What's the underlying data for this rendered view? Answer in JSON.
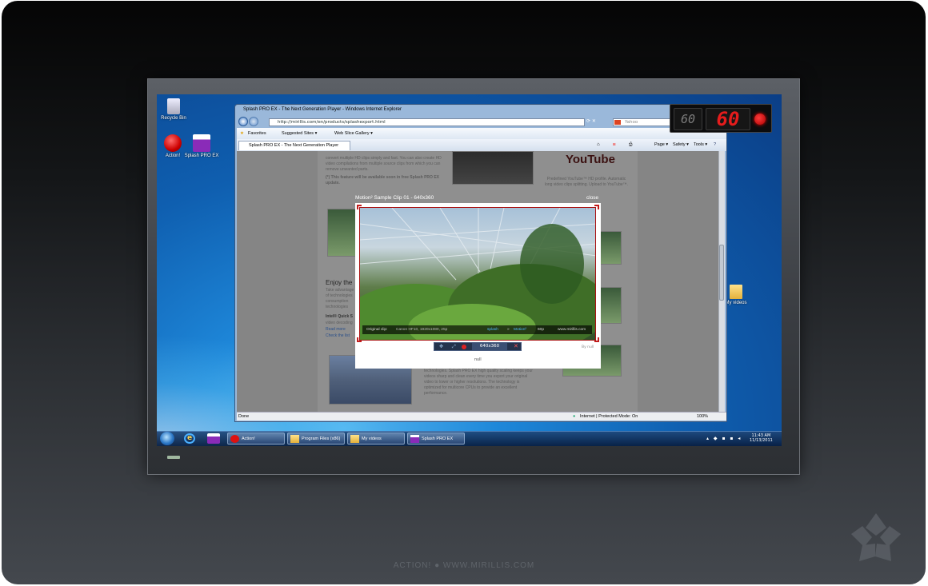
{
  "desktop": {
    "icons": [
      {
        "label": "Recycle Bin"
      },
      {
        "label": "Action!"
      },
      {
        "label": "Splash PRO EX"
      },
      {
        "label": "My videos"
      }
    ]
  },
  "browser": {
    "title": "Splash PRO EX - The Next Generation Player - Windows Internet Explorer",
    "address": "http://mirillis.com/en/products/splashexport.html",
    "search_placeholder": "Yahoo",
    "favorites_label": "Favorites",
    "suggested_sites": "Suggested Sites ▾",
    "web_slice": "Web Slice Gallery ▾",
    "tab_label": "Splash PRO EX - The Next Generation Player",
    "cmd_page": "Page ▾",
    "cmd_safety": "Safety ▾",
    "cmd_tools": "Tools ▾",
    "status_left": "Done",
    "status_zone": "Internet | Protected Mode: On",
    "zoom": "100%"
  },
  "page": {
    "para1": "convert multiple HD clips simply and fast. You can also create HD video compilations from multiple source clips from which you can remove unwanted parts.",
    "para1_note": "(*) This feature will be available soon in free Splash PRO EX update.",
    "youtube_logo": "YouTube",
    "youtube_text": "Predefined YouTube™ HD profile. Automatic long video clips splitting. Upload to YouTube™.",
    "heading": "Enjoy the",
    "para2": "Take advantage of technologies consumption technologies",
    "bold": "Intel® Quick S",
    "para3": "video decoding",
    "link1": "Read more",
    "link2": "Check the list",
    "para4": "technologies. Splash PRO EX high quality scaling keeps your videos sharp and clean every time you export your original video to lower or higher resolutions. The technology is optimized for multicore CPUs to provide an excellent performance."
  },
  "player": {
    "title": "Motion² Sample Clip 01 - 640x360",
    "close": "close",
    "caption_left": "Original clip:",
    "caption_meta": "Canon HF10, 1920x1080, 25p",
    "caption_brand": "splash",
    "caption_arrow": "»",
    "caption_motion": "Motion²",
    "caption_fps": "60p",
    "caption_site": "www.mirillis.com",
    "resolution": "640x360",
    "by_null": "By null",
    "footer_null": "null"
  },
  "counter": {
    "fps_small": "60",
    "fps_large": "60",
    "small_color": "#7c7c7c",
    "large_color": "#e51c1c"
  },
  "taskbar": {
    "buttons": [
      {
        "label": "Action!"
      },
      {
        "label": "Program Files (x86)"
      },
      {
        "label": "My videos"
      },
      {
        "label": "Splash PRO EX"
      }
    ],
    "clock_time": "11:43 AM",
    "clock_date": "11/13/2011"
  },
  "footer": "ACTION!   ●   WWW.MIRILLIS.COM"
}
